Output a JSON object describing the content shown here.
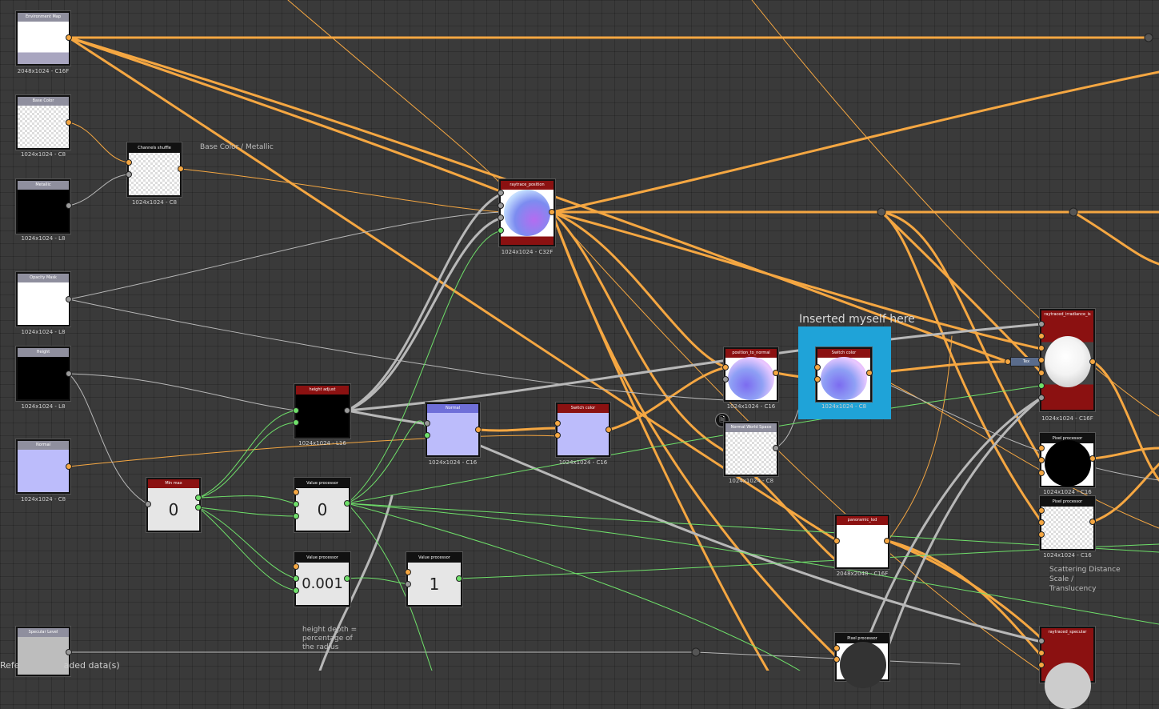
{
  "canvas": {
    "comments": {
      "base_color_metallic": "Base Color / Metallic",
      "scattering": "Scattering Distance Scale / Translucency",
      "height_depth": "height depth = percentage of the radius"
    },
    "frame_title": "Inserted myself here",
    "status": "Refe",
    "status_tail": "aded data(s)"
  },
  "nodes": {
    "env_map": {
      "title": "Environment Map",
      "caption": "2048x1024 - C16F"
    },
    "base_color": {
      "title": "Base Color",
      "caption": "1024x1024 - C8"
    },
    "metallic": {
      "title": "Metallic",
      "caption": "1024x1024 - L8"
    },
    "channels_shuffle": {
      "title": "Channels shuffle",
      "caption": "1024x1024 - C8"
    },
    "opacity_mask": {
      "title": "Opacity Mask",
      "caption": "1024x1024 - L8"
    },
    "height": {
      "title": "Height",
      "caption": "1024x1024 - L8"
    },
    "normal_input": {
      "title": "Normal",
      "caption": "1024x1024 - C8"
    },
    "min_max": {
      "title": "Min max",
      "value": "0"
    },
    "height_adjust": {
      "title": "height adjust",
      "caption": "1024x1024 - L16"
    },
    "value_proc_0": {
      "title": "Value processor",
      "value": "0"
    },
    "value_proc_001": {
      "title": "Value processor",
      "value": "0.001"
    },
    "value_proc_1": {
      "title": "Value processor",
      "value": "1"
    },
    "raytrace_position": {
      "title": "raytrace_position",
      "caption": "1024x1024 - C32F"
    },
    "normal": {
      "title": "Normal",
      "caption": "1024x1024 - C16"
    },
    "switch_color_1": {
      "title": "Switch color",
      "caption": "1024x1024 - C16"
    },
    "position_to_normal": {
      "title": "position_to_normal",
      "caption": "1024x1024 - C16"
    },
    "normal_world_space": {
      "title": "Normal World Space",
      "caption": "1024x1024 - C8"
    },
    "switch_color_2": {
      "title": "Switch color",
      "caption": "1024x1024 - C8"
    },
    "panoramic_lod": {
      "title": "panoramic_lod",
      "caption": "2048x2048 - C16F"
    },
    "raytraced_irradiance": {
      "title": "raytraced_irradiance_is",
      "caption": "1024x1024 - C16F"
    },
    "tex_tag": {
      "title": "Tex"
    },
    "pixel_proc_1": {
      "title": "Pixel processor",
      "caption": "1024x1024 - C16"
    },
    "pixel_proc_2": {
      "title": "Pixel processor",
      "caption": "1024x1024 - C16"
    },
    "pixel_proc_3": {
      "title": "Pixel processor"
    },
    "specular_level": {
      "title": "Specular Level"
    },
    "raytraced_specular": {
      "title": "raytraced_specular"
    }
  },
  "colors": {
    "canvas_bg": "#3a3a3a",
    "wire_color": "#f5a742",
    "wire_gray": "#b8b8b8",
    "wire_value": "#6fe06a",
    "header_input": "#8f8f9e",
    "header_red": "#8b1111",
    "header_black": "#111111",
    "header_blue": "#6f6fd8",
    "frame": "#1fa3d8"
  }
}
